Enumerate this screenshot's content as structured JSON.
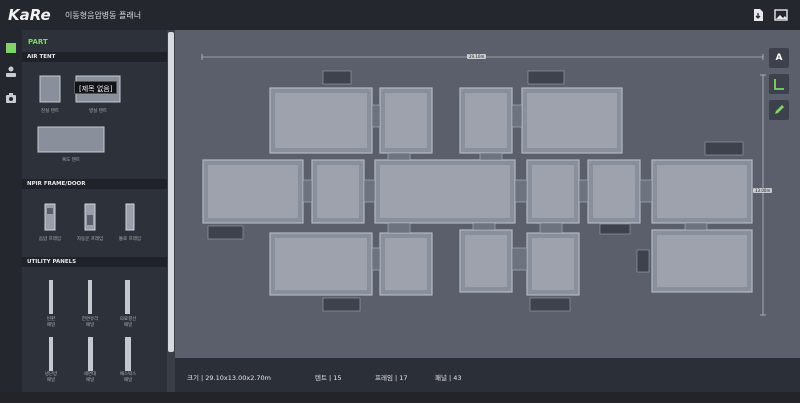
{
  "app": {
    "logo_text": "KaRe",
    "title": "이동형음압병동 플래너"
  },
  "topbar": {
    "export_icon": "file-download-icon",
    "image_icon": "image-icon"
  },
  "iconbar": {
    "items": [
      {
        "icon": "part-square-icon",
        "active": true
      },
      {
        "icon": "people-icon",
        "active": false
      },
      {
        "icon": "camera-icon",
        "active": false
      }
    ]
  },
  "panel": {
    "title": "PART",
    "tooltip": "[제목 없음]",
    "sections": [
      {
        "title": "AIR TENT",
        "items": [
          "진실 텐트",
          "병실 텐트",
          "복도 텐트"
        ]
      },
      {
        "title": "NPIR FRAME/DOOR",
        "items": [
          "음압 프레임",
          "자동문 프레임",
          "통로 프레임"
        ]
      },
      {
        "title": "UTILITY PANELS",
        "items": [
          "빈판\n패널",
          "전면유리\n패널",
          "의료결선\n패널",
          "냉난방\n패널",
          "세면대\n패널",
          "패스박스\n패널"
        ]
      }
    ]
  },
  "canvas": {
    "width_label": "29.10m",
    "height_label": "13.00m"
  },
  "tools": {
    "text_label": "A",
    "ruler_icon": "ruler-icon",
    "pencil_icon": "pencil-icon"
  },
  "status": {
    "size": "크기 | 29.10x13.00x2.70m",
    "tents": "텐트 | 15",
    "frames": "프레임 | 17",
    "panels": "패널 | 43"
  },
  "colors": {
    "accent": "#7fd36a",
    "canvas_bg": "#5a5f6b",
    "tent_fill": "#8a8f9c",
    "tent_border": "#b3b7c0"
  }
}
